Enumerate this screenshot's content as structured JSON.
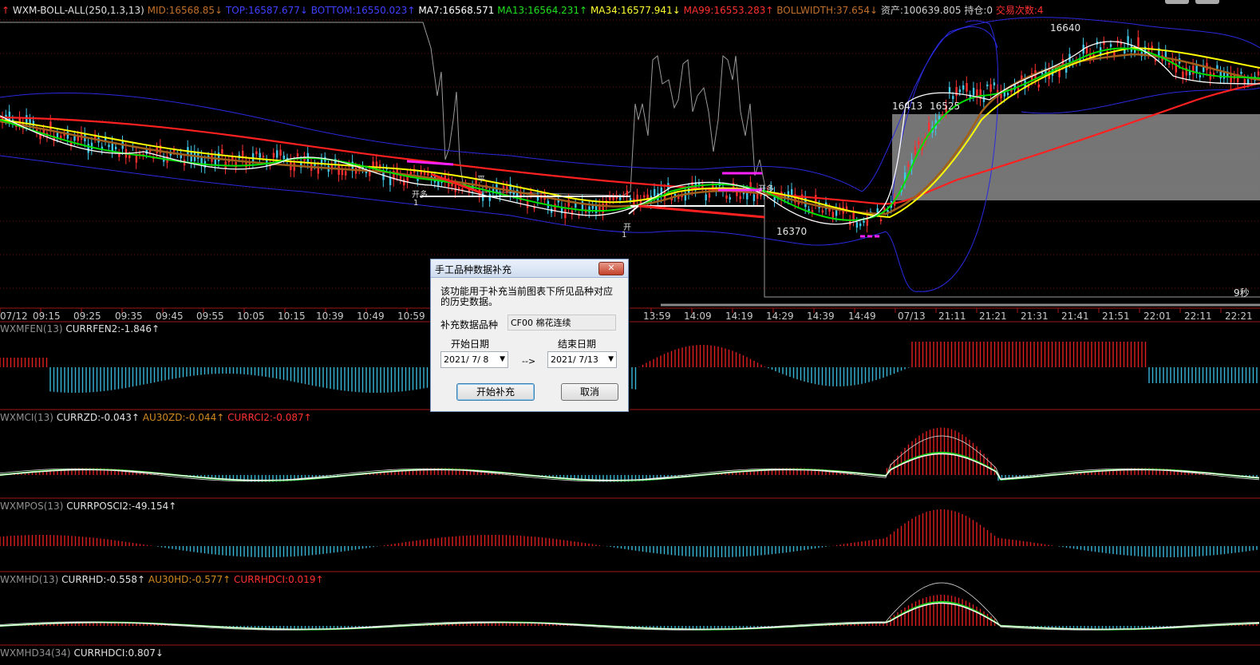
{
  "header": {
    "icon": "up-arrow-icon",
    "name": "WXM-BOLL-ALL(250,1.3,13)",
    "mid": "MID:16568.85↓",
    "top": "TOP:16587.677↓",
    "bottom": "BOTTOM:16550.023↑",
    "ma7": "MA7:16568.571",
    "ma13": "MA13:16564.231↑",
    "ma34": "MA34:16577.941↓",
    "ma99": "MA99:16553.283↑",
    "bollwidth": "BOLLWIDTH:37.654↓",
    "assets": "资产:100639.805",
    "position": "持仓:0",
    "trades": "交易次数:4"
  },
  "price_labels": {
    "high": "16640",
    "low_right_a": "16413",
    "low_right_b": "16525",
    "low_mid": "16370",
    "timer": "9秒"
  },
  "trade_marks": {
    "open_long": "开多",
    "open_long_qty": "1",
    "mark_b": "开",
    "mark_b_qty": "1",
    "mark_c": "平",
    "mark_c2": "开多"
  },
  "time_axis": [
    "07/12",
    "09:15",
    "09:25",
    "09:35",
    "09:45",
    "09:55",
    "10:05",
    "10:15",
    "10:39",
    "10:49",
    "10:59",
    "13:59",
    "14:09",
    "14:19",
    "14:29",
    "14:39",
    "14:49",
    "07/13",
    "21:11",
    "21:21",
    "21:31",
    "21:41",
    "21:51",
    "22:01",
    "22:11",
    "22:21"
  ],
  "panels": [
    {
      "name": "WXMFEN(13)",
      "v1": "CURRFEN2:-1.846↑"
    },
    {
      "name": "WXMCI(13)",
      "v1": "CURRZD:-0.043↑",
      "v2": "AU30ZD:-0.044↑",
      "v3": "CURRCI2:-0.087↑"
    },
    {
      "name": "WXMPOS(13)",
      "v1": "CURRPOSCI2:-49.154↑"
    },
    {
      "name": "WXMHD(13)",
      "v1": "CURRHD:-0.558↑",
      "v2": "AU30HD:-0.577↑",
      "v3": "CURRHDCI:0.019↑"
    },
    {
      "name": "WXMHD34(34)",
      "v1": "CURRHDCI:0.807↓"
    }
  ],
  "dialog": {
    "title": "手工品种数据补充",
    "close_icon": "close-icon",
    "description": "该功能用于补充当前图表下所见品种对应的历史数据。",
    "symbol_label": "补充数据品种",
    "symbol_value": "CF00 棉花连续",
    "start_label": "开始日期",
    "end_label": "结束日期",
    "start_date": "2021/ 7/ 8",
    "end_date": "2021/ 7/13",
    "arrow": "-->",
    "start_button": "开始补充",
    "cancel_button": "取消"
  },
  "colors": {
    "ma7": "#ffffff",
    "ma13": "#00e000",
    "ma34": "#ffff00",
    "ma99": "#ff2020",
    "boll": "#3030ff",
    "mid": "#b06a10",
    "candle_up": "#ff3030",
    "candle_down": "#40c8e8",
    "grid": "#8a1010"
  },
  "chart_data": [
    {
      "type": "line",
      "title": "",
      "series": [
        {
          "name": "MA7"
        },
        {
          "name": "MA13"
        },
        {
          "name": "MA34"
        },
        {
          "name": "MA99"
        }
      ]
    },
    {
      "type": "bar",
      "title": "",
      "series": [
        {
          "name": "CURRFEN2"
        }
      ]
    },
    {
      "type": "bar",
      "title": "",
      "series": [
        {
          "name": "CURRZD"
        },
        {
          "name": "AU30ZD"
        },
        {
          "name": "CURRCI2"
        }
      ]
    },
    {
      "type": "bar",
      "title": "",
      "series": [
        {
          "name": "CURRPOSCI2"
        }
      ]
    },
    {
      "type": "bar",
      "title": "",
      "series": [
        {
          "name": "CURRHD"
        },
        {
          "name": "AU30HD"
        },
        {
          "name": "CURRHDCI"
        }
      ]
    }
  ]
}
